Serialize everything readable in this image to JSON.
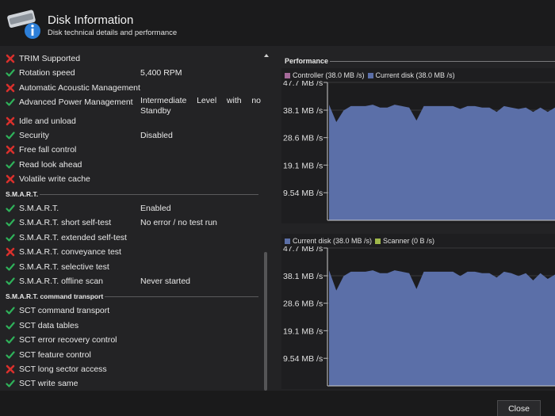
{
  "header": {
    "title": "Disk Information",
    "subtitle": "Disk technical details and performance"
  },
  "features": [
    {
      "label": "TRIM Supported",
      "status": "no",
      "value": ""
    },
    {
      "label": "Rotation speed",
      "status": "yes",
      "value": "5,400 RPM"
    },
    {
      "label": "Automatic Acoustic Management",
      "status": "no",
      "value": ""
    },
    {
      "label": "Advanced Power Management",
      "status": "yes",
      "value": "Intermediate Level with no Standby"
    },
    {
      "label": "Idle and unload",
      "status": "no",
      "value": ""
    },
    {
      "label": "Security",
      "status": "yes",
      "value": "Disabled"
    },
    {
      "label": "Free fall control",
      "status": "no",
      "value": ""
    },
    {
      "label": "Read look ahead",
      "status": "yes",
      "value": ""
    },
    {
      "label": "Volatile write cache",
      "status": "no",
      "value": ""
    }
  ],
  "smart": {
    "section_label": "S.M.A.R.T.",
    "items": [
      {
        "label": "S.M.A.R.T.",
        "status": "yes",
        "value": "Enabled"
      },
      {
        "label": "S.M.A.R.T. short self-test",
        "status": "yes",
        "value": "No error / no test run"
      },
      {
        "label": "S.M.A.R.T. extended self-test",
        "status": "yes",
        "value": ""
      },
      {
        "label": "S.M.A.R.T. conveyance test",
        "status": "no",
        "value": ""
      },
      {
        "label": "S.M.A.R.T. selective test",
        "status": "yes",
        "value": ""
      },
      {
        "label": "S.M.A.R.T. offline scan",
        "status": "yes",
        "value": "Never started"
      }
    ]
  },
  "sct": {
    "section_label": "S.M.A.R.T. command transport",
    "items": [
      {
        "label": "SCT command transport",
        "status": "yes",
        "value": ""
      },
      {
        "label": "SCT data tables",
        "status": "yes",
        "value": ""
      },
      {
        "label": "SCT error recovery control",
        "status": "yes",
        "value": ""
      },
      {
        "label": "SCT feature control",
        "status": "yes",
        "value": ""
      },
      {
        "label": "SCT long sector access",
        "status": "no",
        "value": ""
      },
      {
        "label": "SCT write same",
        "status": "yes",
        "value": ""
      }
    ]
  },
  "performance": {
    "title": "Performance"
  },
  "colors": {
    "yes": "#2fb25a",
    "no": "#d9302c",
    "controller": "#a56a9a",
    "current_disk": "#5b6fa8",
    "scanner": "#9fb84a",
    "chart_fill": "#5b6fa8"
  },
  "chart_data": [
    {
      "type": "area",
      "legend": [
        {
          "name": "Controller (38.0 MB /s)",
          "color": "#a56a9a"
        },
        {
          "name": "Current disk (38.0 MB /s)",
          "color": "#5b6fa8"
        }
      ],
      "ytick_labels": [
        "47.7 MB /s",
        "38.1 MB /s",
        "28.6 MB /s",
        "19.1 MB /s",
        "9.54 MB /s"
      ],
      "yticks": [
        47.7,
        38.1,
        28.6,
        19.1,
        9.54
      ],
      "ylim": [
        0,
        47.7
      ],
      "series": [
        {
          "name": "Current disk",
          "values": [
            40,
            34,
            38,
            39.5,
            39.5,
            39.5,
            40,
            39,
            39,
            40,
            39.5,
            39,
            34.5,
            39.5,
            39.5,
            39.5,
            39.5,
            39.5,
            38.5,
            39.5,
            39.5,
            39,
            39,
            37.5,
            39.5,
            39,
            38.5,
            39,
            37.5,
            39,
            37.5,
            39
          ]
        }
      ]
    },
    {
      "type": "area",
      "legend": [
        {
          "name": "Current disk (38.0 MB /s)",
          "color": "#5b6fa8"
        },
        {
          "name": "Scanner (0 B /s)",
          "color": "#9fb84a"
        }
      ],
      "ytick_labels": [
        "47.7 MB /s",
        "38.1 MB /s",
        "28.6 MB /s",
        "19.1 MB /s",
        "9.54 MB /s"
      ],
      "yticks": [
        47.7,
        38.1,
        28.6,
        19.1,
        9.54
      ],
      "ylim": [
        0,
        47.7
      ],
      "series": [
        {
          "name": "Current disk",
          "values": [
            40,
            33,
            38,
            39.5,
            39.5,
            39.5,
            40,
            39,
            39,
            40,
            39.5,
            39,
            33.5,
            39.5,
            39.5,
            39.5,
            39.5,
            39.5,
            38,
            39.5,
            39.5,
            39,
            39,
            37.5,
            39.5,
            39,
            38,
            39,
            36.5,
            39,
            37,
            38.5
          ]
        }
      ]
    }
  ],
  "footer": {
    "close_label": "Close"
  }
}
